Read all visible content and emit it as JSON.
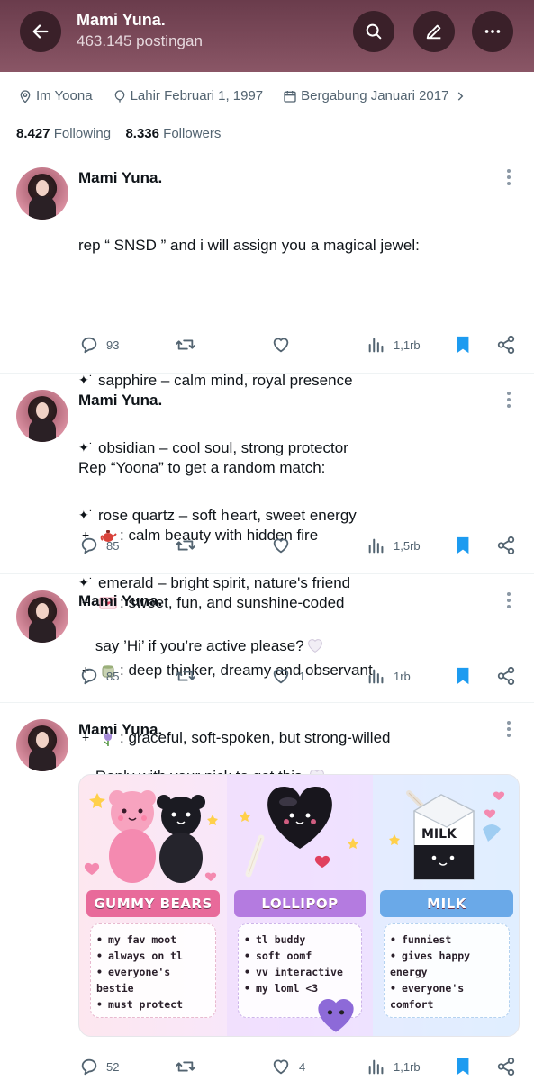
{
  "header": {
    "title": "Mami Yuna.",
    "subtitle": "463.145 postingan"
  },
  "profile": {
    "location": "Im Yoona",
    "birth": "Lahir Februari 1, 1997",
    "joined": "Bergabung Januari 2017",
    "following_count": "8.427",
    "following_label": "Following",
    "followers_count": "8.336",
    "followers_label": "Followers"
  },
  "posts": [
    {
      "author": "Mami Yuna.",
      "intro": "rep “ SNSD ” and i will assign you a magical jewel:",
      "items": [
        "sapphire – calm mind, royal presence",
        "obsidian – cool soul, strong protector",
        "rose quartz – soft h eart, sweet energy",
        "emerald – bright spirit, nature's friend"
      ],
      "bullet": "✦˙",
      "replies": "93",
      "retweets": "",
      "likes": "",
      "views": "1,1rb"
    },
    {
      "author": "Mami Yuna.",
      "intro": "Rep “Yoona” to get a random match:",
      "items": [
        ": calm beauty with hidden fire",
        ": sweet, fun, and sunshine-coded",
        ": deep thinker, dreamy and observant",
        ": graceful, soft-spoken, but strong-willed"
      ],
      "item_icons": [
        "teapot-icon",
        "letter-icon",
        "tea-cup-icon",
        "tulip-icon"
      ],
      "bullet": "+",
      "replies": "85",
      "retweets": "",
      "likes": "",
      "views": "1,5rb"
    },
    {
      "author": "Mami Yuna.",
      "text": "say ’Hi’ if you’re active please?",
      "replies": "85",
      "retweets": "",
      "likes": "1",
      "views": "1rb"
    },
    {
      "author": "Mami Yuna.",
      "text": "Reply with your nick to get this.",
      "replies": "52",
      "retweets": "",
      "likes": "4",
      "views": "1,1rb",
      "image": {
        "panels": [
          {
            "title": "GUMMY BEARS",
            "items": [
              "my fav moot",
              "always on tl",
              "everyone's",
              "bestie",
              "must protect"
            ],
            "color": "#e86a9a"
          },
          {
            "title": "LOLLIPOP",
            "items": [
              "tl buddy",
              "soft oomf",
              "vv interactive",
              "my loml <3"
            ],
            "color": "#b47be0"
          },
          {
            "title": "MILK",
            "items": [
              "funniest",
              "gives happy",
              "energy",
              "everyone's",
              "comfort"
            ],
            "color": "#6aa9e8"
          }
        ],
        "milk_carton_label": "MILK"
      }
    }
  ],
  "colors": {
    "header_bg": "#7d4b5b",
    "bookmark_blue": "#1d9bf0",
    "muted": "#536471"
  }
}
